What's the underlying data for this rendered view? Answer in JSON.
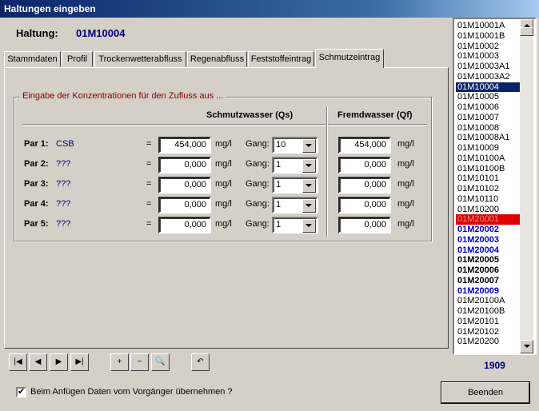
{
  "window": {
    "title": "Haltungen eingeben"
  },
  "header": {
    "label": "Haltung:",
    "value": "01M10004"
  },
  "tabs": [
    {
      "label": "Stammdaten"
    },
    {
      "label": "Profil"
    },
    {
      "label": "Trockenwetterabfluss"
    },
    {
      "label": "Regenabfluss"
    },
    {
      "label": "Feststoffeintrag"
    },
    {
      "label": "Schmutzeintrag"
    }
  ],
  "group": {
    "title": "Eingabe der Konzentrationen für den Zufluss aus ...",
    "col_qs": "Schmutzwasser (Qs)",
    "col_qf": "Fremdwasser (Qf)"
  },
  "rows": [
    {
      "label": "Par 1:",
      "name": "CSB",
      "eq": "=",
      "qs": "454,000",
      "unit": "mg/l",
      "gang_label": "Gang:",
      "gang": "10",
      "qf": "454,000",
      "unit2": "mg/l"
    },
    {
      "label": "Par 2:",
      "name": "???",
      "eq": "=",
      "qs": "0,000",
      "unit": "mg/l",
      "gang_label": "Gang:",
      "gang": "1",
      "qf": "0,000",
      "unit2": "mg/l"
    },
    {
      "label": "Par 3:",
      "name": "???",
      "eq": "=",
      "qs": "0,000",
      "unit": "mg/l",
      "gang_label": "Gang:",
      "gang": "1",
      "qf": "0,000",
      "unit2": "mg/l"
    },
    {
      "label": "Par 4:",
      "name": "???",
      "eq": "=",
      "qs": "0,000",
      "unit": "mg/l",
      "gang_label": "Gang:",
      "gang": "1",
      "qf": "0,000",
      "unit2": "mg/l"
    },
    {
      "label": "Par 5:",
      "name": "???",
      "eq": "=",
      "qs": "0,000",
      "unit": "mg/l",
      "gang_label": "Gang:",
      "gang": "1",
      "qf": "0,000",
      "unit2": "mg/l"
    }
  ],
  "toolbar": {
    "buttons": [
      {
        "icon": "first-record-icon",
        "glyph": "|◀"
      },
      {
        "icon": "prev-record-icon",
        "glyph": "◀"
      },
      {
        "icon": "next-record-icon",
        "glyph": "▶"
      },
      {
        "icon": "last-record-icon",
        "glyph": "▶|"
      },
      {
        "icon": "add-record-icon",
        "glyph": "+"
      },
      {
        "icon": "delete-record-icon",
        "glyph": "−"
      },
      {
        "icon": "search-icon",
        "glyph": "🔍"
      },
      {
        "icon": "undo-icon",
        "glyph": "↶"
      }
    ]
  },
  "footer": {
    "checkbox_label": "Beim Anfügen Daten vom Vorgänger übernehmen ?",
    "checkbox_checked": "✔",
    "close_button": "Beenden"
  },
  "list": {
    "items": [
      {
        "text": "01M10001A",
        "style": "normal"
      },
      {
        "text": "01M10001B",
        "style": "normal"
      },
      {
        "text": "01M10002",
        "style": "normal"
      },
      {
        "text": "01M10003",
        "style": "normal"
      },
      {
        "text": "01M10003A1",
        "style": "normal"
      },
      {
        "text": "01M10003A2",
        "style": "normal"
      },
      {
        "text": "01M10004",
        "style": "sel"
      },
      {
        "text": "01M10005",
        "style": "normal"
      },
      {
        "text": "01M10006",
        "style": "normal"
      },
      {
        "text": "01M10007",
        "style": "normal"
      },
      {
        "text": "01M10008",
        "style": "normal"
      },
      {
        "text": "01M10008A1",
        "style": "normal"
      },
      {
        "text": "01M10009",
        "style": "normal"
      },
      {
        "text": "01M10100A",
        "style": "normal"
      },
      {
        "text": "01M10100B",
        "style": "normal"
      },
      {
        "text": "01M10101",
        "style": "normal"
      },
      {
        "text": "01M10102",
        "style": "normal"
      },
      {
        "text": "01M10110",
        "style": "normal"
      },
      {
        "text": "01M10200",
        "style": "normal"
      },
      {
        "text": "01M20001",
        "style": "red"
      },
      {
        "text": "01M20002",
        "style": "blue"
      },
      {
        "text": "01M20003",
        "style": "blue"
      },
      {
        "text": "01M20004",
        "style": "blue"
      },
      {
        "text": "01M20005",
        "style": "bold"
      },
      {
        "text": "01M20006",
        "style": "bold"
      },
      {
        "text": "01M20007",
        "style": "bold"
      },
      {
        "text": "01M20009",
        "style": "blue"
      },
      {
        "text": "01M20100A",
        "style": "normal"
      },
      {
        "text": "01M20100B",
        "style": "normal"
      },
      {
        "text": "01M20101",
        "style": "normal"
      },
      {
        "text": "01M20102",
        "style": "normal"
      },
      {
        "text": "01M20200",
        "style": "normal"
      }
    ],
    "count": "1909"
  }
}
